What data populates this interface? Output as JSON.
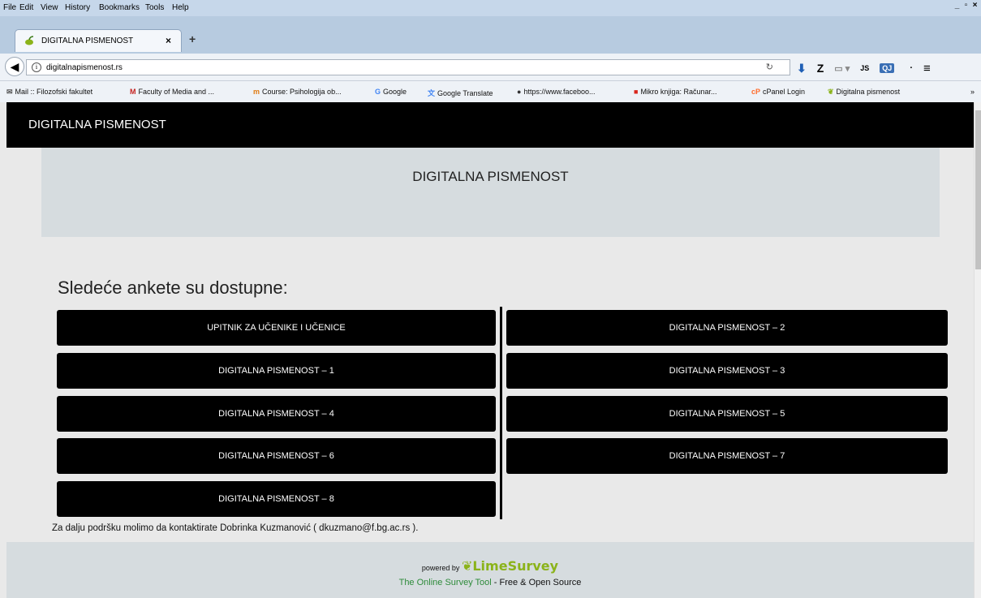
{
  "menubar": {
    "items": [
      "File",
      "Edit",
      "View",
      "History",
      "Bookmarks",
      "Tools",
      "Help"
    ]
  },
  "tab": {
    "title": "DIGITALNA PISMENOST",
    "close": "×",
    "new": "+"
  },
  "nav": {
    "url": "digitalnapismenost.rs",
    "js": "JS",
    "qj": "QJ"
  },
  "bookmarks": [
    "Mail :: Filozofski fakultet",
    "Faculty of Media and ...",
    "Course: Psihologija ob...",
    "Google",
    "Google Translate",
    "https://www.faceboo...",
    "Mikro knjiga: Računar...",
    "cPanel Login",
    "Digitalna pismenost"
  ],
  "site": {
    "brand": "DIGITALNA PISMENOST",
    "jumbo_title": "DIGITALNA PISMENOST",
    "heading": "Sledeće ankete su dostupne:",
    "surveys_left": [
      "UPITNIK ZA UČENIKE I UČENICE",
      "DIGITALNA PISMENOST – 1",
      "DIGITALNA PISMENOST – 4",
      "DIGITALNA PISMENOST – 6",
      "DIGITALNA PISMENOST – 8"
    ],
    "surveys_right": [
      "DIGITALNA PISMENOST – 2",
      "DIGITALNA PISMENOST – 3",
      "DIGITALNA PISMENOST – 5",
      "DIGITALNA PISMENOST – 7"
    ],
    "contact": "Za dalju podršku molimo da kontaktirate Dobrinka Kuzmanović ( dkuzmano@f.bg.ac.rs )."
  },
  "footer": {
    "powered_by": "powered by",
    "brand": "LimeSurvey",
    "tool_link": "The Online Survey Tool",
    "tool_rest": " - Free & Open Source"
  }
}
